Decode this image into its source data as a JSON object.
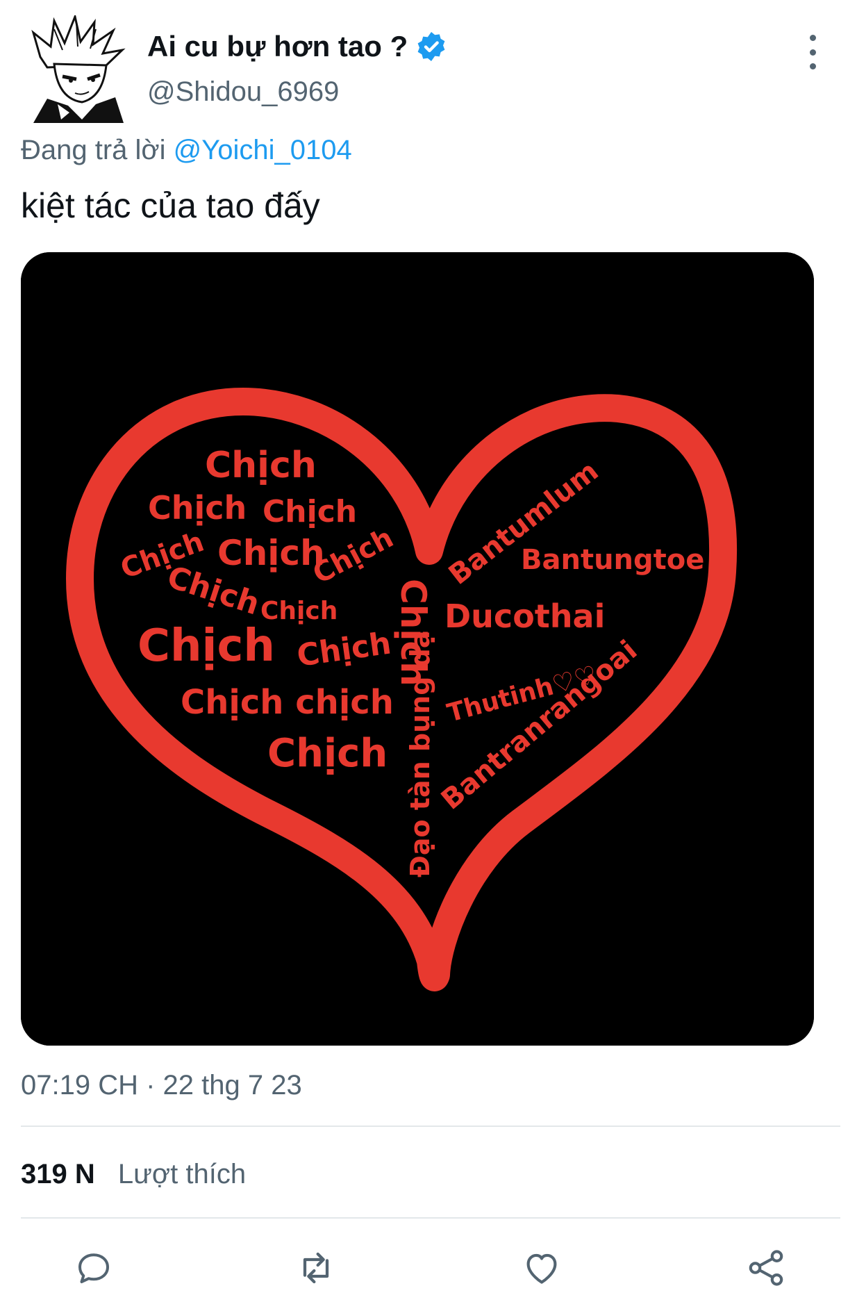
{
  "tweet": {
    "display_name": "Ai cu bự hơn tao ?",
    "handle": "@Shidou_6969",
    "reply_prefix": "Đang trả lời",
    "reply_mention": "@Yoichi_0104",
    "text": "kiệt tác của tao đấy",
    "timestamp": "07:19 CH · 22 thg 7 23",
    "likes_count": "319 N",
    "likes_label": "Lượt thích"
  },
  "media": {
    "words_left": [
      "Chịch",
      "Chịch",
      "Chịch",
      "Chịch",
      "Chịch",
      "Chịch",
      "Chịch",
      "Chịch",
      "Chịch",
      "Chịch",
      "Chịch chịch",
      "Chịch"
    ],
    "center_word": "Chịch",
    "center_subtitle": "Đạo tàn bụng dạ",
    "words_right": [
      "Bantumlum",
      "Bantungtoe",
      "Ducothai",
      "Thutinh♡♡",
      "Bantranrangoai"
    ]
  },
  "icons": {
    "verified": "verified-badge-icon",
    "more": "more-vertical-icon",
    "reply": "reply-bubble-icon",
    "retweet": "retweet-icon",
    "like": "heart-icon",
    "share": "share-icon"
  },
  "colors": {
    "accent": "#1d9bf0",
    "secondary_text": "#536471",
    "heart_red": "#e8392f"
  }
}
